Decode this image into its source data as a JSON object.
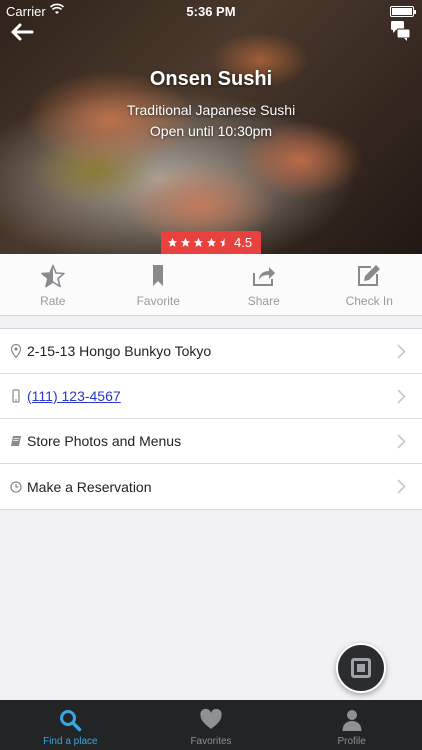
{
  "status_bar": {
    "carrier": "Carrier",
    "time": "5:36 PM"
  },
  "place": {
    "name": "Onsen Sushi",
    "subtitle": "Traditional Japanese Sushi",
    "hours": "Open until 10:30pm",
    "rating": 4.5,
    "rating_text": "4.5"
  },
  "actions": [
    {
      "label": "Rate",
      "icon": "star-icon"
    },
    {
      "label": "Favorite",
      "icon": "bookmark-icon"
    },
    {
      "label": "Share",
      "icon": "share-icon"
    },
    {
      "label": "Check In",
      "icon": "edit-icon"
    }
  ],
  "details": [
    {
      "label": "2-15-13 Hongo Bunkyo Tokyo",
      "icon": "location-pin-icon"
    },
    {
      "label": "(111) 123-4567",
      "icon": "phone-icon"
    },
    {
      "label": "Store Photos and Menus",
      "icon": "book-icon"
    },
    {
      "label": "Make a Reservation",
      "icon": "clock-icon"
    }
  ],
  "tabs": [
    {
      "label": "Find a place",
      "icon": "search-icon",
      "active": true
    },
    {
      "label": "Favorites",
      "icon": "heart-icon",
      "active": false
    },
    {
      "label": "Profile",
      "icon": "person-icon",
      "active": false
    }
  ],
  "colors": {
    "accent": "#3aa6e0",
    "rating_badge": "#e8413e",
    "link": "#2a35c9",
    "tab_bar": "#222426"
  }
}
